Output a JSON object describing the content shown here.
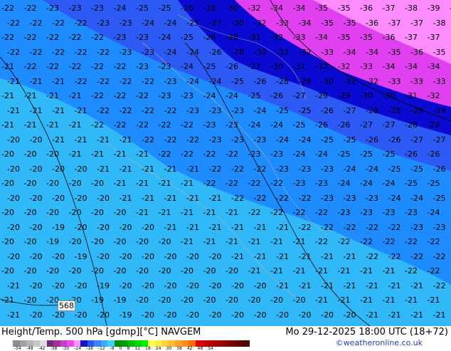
{
  "footer": {
    "title": "Height/Temp. 500 hPa [gdmp][°C] NAVGEM",
    "datetime": "Mo 29-12-2025 18:00 UTC (18+72)",
    "credit": "©weatheronline.co.uk"
  },
  "legend": {
    "ticks": [
      "-54",
      "-48",
      "-42",
      "-38",
      "-30",
      "-24",
      "-18",
      "-12",
      "-8",
      "0",
      "8",
      "12",
      "18",
      "24",
      "30",
      "38",
      "42",
      "48",
      "54"
    ],
    "colors": [
      "#8c8c8c",
      "#a0a0a0",
      "#b4b4b4",
      "#c8c8c8",
      "#dcdcdc",
      "#782878",
      "#a030a0",
      "#c83cc8",
      "#f046f0",
      "#ff96ff",
      "#1414c8",
      "#285af0",
      "#3c82ff",
      "#3caaff",
      "#3cd2ff",
      "#008c00",
      "#00a000",
      "#00be00",
      "#00dc00",
      "#00f000",
      "#ffff50",
      "#fff03c",
      "#ffd23c",
      "#ffbe32",
      "#ffa028",
      "#ff8c14",
      "#ff6e00",
      "#e10000",
      "#c80000",
      "#b40000",
      "#a00000",
      "#8c0000",
      "#780000",
      "#640000",
      "#500000"
    ]
  },
  "contour_label": "568",
  "colors": {
    "light_blue": "#30b8f8",
    "mid_blue": "#1e8cff",
    "blue": "#2d5af5",
    "dark_blue": "#0a0ad2",
    "magenta": "#e040f0",
    "pink": "#ff8cff"
  },
  "labels": [
    [
      "-22",
      "-22",
      "-23",
      "-23",
      "-23",
      "-24",
      "-25",
      "-25",
      "-26",
      "-28",
      "-30",
      "-32",
      "-34",
      "-34",
      "-35",
      "-35",
      "-36",
      "-37",
      "-38",
      "-39",
      "-40"
    ],
    [
      "-22",
      "-22",
      "-22",
      "-22",
      "-23",
      "-23",
      "-24",
      "-24",
      "-25",
      "-27",
      "-30",
      "-32",
      "-33",
      "-34",
      "-35",
      "-35",
      "-36",
      "-37",
      "-37",
      "-38"
    ],
    [
      "-22",
      "-22",
      "-22",
      "-22",
      "-22",
      "-23",
      "-23",
      "-24",
      "-25",
      "-26",
      "-28",
      "-31",
      "-32",
      "-33",
      "-34",
      "-35",
      "-35",
      "-36",
      "-37",
      "-37"
    ],
    [
      "-22",
      "-22",
      "-22",
      "-22",
      "-22",
      "-23",
      "-23",
      "-24",
      "-24",
      "-26",
      "-28",
      "-30",
      "-32",
      "-32",
      "-33",
      "-34",
      "-34",
      "-35",
      "-36",
      "-35"
    ],
    [
      "-21",
      "-22",
      "-22",
      "-22",
      "-22",
      "-22",
      "-23",
      "-23",
      "-24",
      "-25",
      "-26",
      "-27",
      "-30",
      "-31",
      "-32",
      "-32",
      "-33",
      "-34",
      "-34",
      "-34"
    ],
    [
      "-21",
      "-21",
      "-21",
      "-22",
      "-22",
      "-22",
      "-22",
      "-23",
      "-24",
      "-24",
      "-25",
      "-26",
      "-28",
      "-29",
      "-30",
      "-31",
      "-32",
      "-33",
      "-33",
      "-33"
    ],
    [
      "-21",
      "-21",
      "-21",
      "-21",
      "-22",
      "-22",
      "-22",
      "-23",
      "-23",
      "-24",
      "-24",
      "-25",
      "-26",
      "-27",
      "-29",
      "-29",
      "-30",
      "-30",
      "-31",
      "-32"
    ],
    [
      "-21",
      "-21",
      "-21",
      "-21",
      "-22",
      "-22",
      "-22",
      "-22",
      "-23",
      "-23",
      "-23",
      "-24",
      "-25",
      "-25",
      "-26",
      "-27",
      "-28",
      "-28",
      "-29",
      "-29"
    ],
    [
      "-21",
      "-21",
      "-21",
      "-21",
      "-22",
      "-22",
      "-22",
      "-22",
      "-22",
      "-23",
      "-23",
      "-24",
      "-24",
      "-25",
      "-26",
      "-26",
      "-27",
      "-27",
      "-28",
      "-28"
    ],
    [
      "-20",
      "-20",
      "-21",
      "-21",
      "-21",
      "-21",
      "-22",
      "-22",
      "-22",
      "-23",
      "-23",
      "-23",
      "-24",
      "-24",
      "-25",
      "-25",
      "-26",
      "-26",
      "-27",
      "-27"
    ],
    [
      "-20",
      "-20",
      "-20",
      "-21",
      "-21",
      "-21",
      "-21",
      "-22",
      "-22",
      "-22",
      "-22",
      "-23",
      "-23",
      "-24",
      "-24",
      "-25",
      "-25",
      "-25",
      "-26",
      "-26"
    ],
    [
      "-20",
      "-20",
      "-20",
      "-20",
      "-21",
      "-21",
      "-21",
      "-21",
      "-21",
      "-22",
      "-22",
      "-22",
      "-23",
      "-23",
      "-23",
      "-24",
      "-24",
      "-25",
      "-25",
      "-26"
    ],
    [
      "-20",
      "-20",
      "-20",
      "-20",
      "-20",
      "-21",
      "-21",
      "-21",
      "-21",
      "-22",
      "-22",
      "-22",
      "-22",
      "-23",
      "-23",
      "-24",
      "-24",
      "-24",
      "-25",
      "-25"
    ],
    [
      "-20",
      "-20",
      "-20",
      "-20",
      "-20",
      "-21",
      "-21",
      "-21",
      "-21",
      "-21",
      "-22",
      "-22",
      "-22",
      "-22",
      "-23",
      "-23",
      "-23",
      "-24",
      "-24",
      "-25"
    ],
    [
      "-20",
      "-20",
      "-20",
      "-20",
      "-20",
      "-20",
      "-21",
      "-21",
      "-21",
      "-21",
      "-21",
      "-22",
      "-22",
      "-22",
      "-22",
      "-23",
      "-23",
      "-23",
      "-23",
      "-24"
    ],
    [
      "-20",
      "-20",
      "-19",
      "-20",
      "-20",
      "-20",
      "-20",
      "-21",
      "-21",
      "-21",
      "-21",
      "-21",
      "-21",
      "-22",
      "-22",
      "-22",
      "-22",
      "-22",
      "-23",
      "-23"
    ],
    [
      "-20",
      "-20",
      "-19",
      "-20",
      "-20",
      "-20",
      "-20",
      "-20",
      "-21",
      "-21",
      "-21",
      "-21",
      "-21",
      "-21",
      "-22",
      "-22",
      "-22",
      "-22",
      "-22",
      "-22"
    ],
    [
      "-20",
      "-20",
      "-20",
      "-19",
      "-20",
      "-20",
      "-20",
      "-20",
      "-20",
      "-20",
      "-21",
      "-21",
      "-21",
      "-21",
      "-21",
      "-21",
      "-22",
      "-22",
      "-22",
      "-22"
    ],
    [
      "-20",
      "-20",
      "-20",
      "-20",
      "-20",
      "-20",
      "-20",
      "-20",
      "-20",
      "-20",
      "-20",
      "-21",
      "-21",
      "-21",
      "-21",
      "-21",
      "-21",
      "-21",
      "-22",
      "-22"
    ],
    [
      "-21",
      "-20",
      "-20",
      "-20",
      "-19",
      "-20",
      "-20",
      "-20",
      "-20",
      "-20",
      "-20",
      "-20",
      "-21",
      "-21",
      "-21",
      "-21",
      "-21",
      "-21",
      "-21",
      "-22"
    ],
    [
      "-21",
      "-20",
      "-20",
      "-20",
      "-19",
      "-19",
      "-20",
      "-20",
      "-20",
      "-20",
      "-20",
      "-20",
      "-20",
      "-20",
      "-21",
      "-21",
      "-21",
      "-21",
      "-21",
      "-21"
    ],
    [
      "-21",
      "-20",
      "-20",
      "-20",
      "-20",
      "-19",
      "-20",
      "-20",
      "-20",
      "-20",
      "-20",
      "-20",
      "-20",
      "-20",
      "-20",
      "-20",
      "-21",
      "-21",
      "-21",
      "-21"
    ]
  ]
}
